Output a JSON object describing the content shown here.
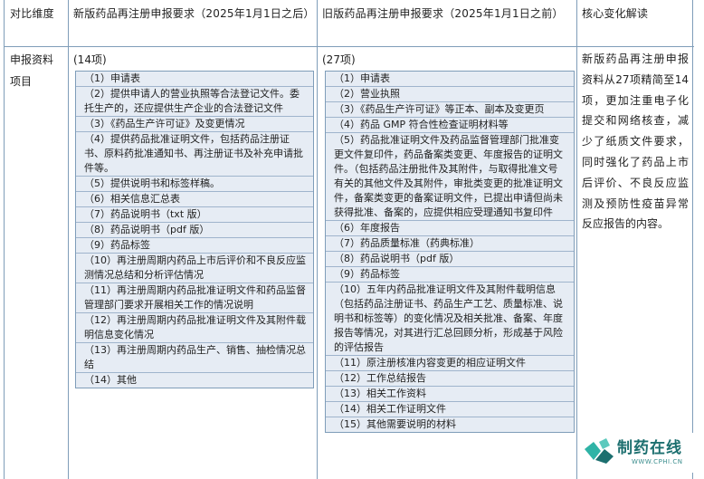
{
  "header": {
    "col1": "对比维度",
    "col2": "新版药品再注册申报要求（2025年1月1日之后）",
    "col3": "旧版药品再注册申报要求（2025年1月1日之前）",
    "col4": "核心变化解读"
  },
  "row": {
    "dimension": "申报资料项目",
    "new_count": "(14项)",
    "old_count": "(27项)",
    "new_items": [
      "（1）申请表",
      "（2）提供申请人的营业执照等合法登记文件。委托生产的，还应提供生产企业的合法登记文件",
      "（3）《药品生产许可证》及变更情况",
      "（4）提供药品批准证明文件，包括药品注册证书、原料药批准通知书、再注册证书及补充申请批件等。",
      "（5）提供说明书和标签样稿。",
      "（6）相关信息汇总表",
      "（7）药品说明书（txt 版）",
      "（8）药品说明书（pdf 版）",
      "（9）药品标签",
      "（10）再注册周期内药品上市后评价和不良反应监测情况总结和分析评估情况",
      "（11）再注册周期内药品批准证明文件和药品监督管理部门要求开展相关工作的情况说明",
      "（12）再注册周期内药品批准证明文件及其附件载明信息变化情况",
      "（13）再注册周期内药品生产、销售、抽检情况总结",
      "（14）其他"
    ],
    "old_items": [
      "（1）申请表",
      "（2）营业执照",
      "（3）《药品生产许可证》等正本、副本及变更页",
      "（4）药品 GMP 符合性检查证明材料等",
      "（5）药品批准证明文件及药品监督管理部门批准变更文件复印件，药品备案类变更、年度报告的证明文件。（包括药品注册批件及其附件，与取得批准文号有关的其他文件及其附件，审批类变更的批准证明文件，备案类变更的备案证明文件，已提出申请但尚未获得批准、备案的，应提供相应受理通知书复印件",
      "（6）年度报告",
      "（7）药品质量标准（药典标准）",
      "（8）药品说明书（pdf 版）",
      "（9）药品标签",
      "（10）五年内药品批准证明文件及其附件载明信息（包括药品注册证书、药品生产工艺、质量标准、说明书和标签等）的变化情况及相关批准、备案、年度报告等情况，对其进行汇总回顾分析，形成基于风险的评估报告",
      "（11）原注册核准内容变更的相应证明文件",
      "（12）工作总结报告",
      "（13）相关工作资料",
      "（14）相关工作证明文件",
      "（15）其他需要说明的材料"
    ],
    "interpretation": "新版药品再注册申报资料从27项精简至14项，更加注重电子化提交和网络核查，减少了纸质文件要求，同时强化了药品上市后评价、不良反应监测及预防性疫苗异常反应报告的内容。"
  },
  "logo": {
    "name": "制药在线",
    "url": "WWW.CPHI.CN",
    "colors": {
      "primary": "#1c6f6f",
      "accent": "#2fb3a6"
    }
  },
  "colors": {
    "border": "#7f9db9",
    "item_bg": "#e6ecf4"
  }
}
